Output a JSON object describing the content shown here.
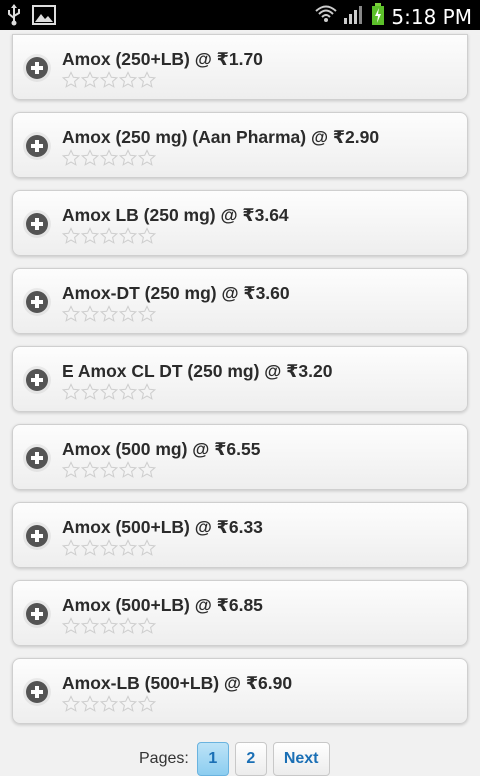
{
  "status_bar": {
    "time": "5:18 PM",
    "icons": [
      "usb-icon",
      "image-icon",
      "wifi-icon",
      "signal-icon",
      "battery-icon"
    ]
  },
  "items": [
    {
      "title": "Amox (250+LB) @ ₹1.70",
      "rating": 0
    },
    {
      "title": "Amox (250 mg) (Aan Pharma) @ ₹2.90",
      "rating": 0
    },
    {
      "title": "Amox LB (250 mg) @ ₹3.64",
      "rating": 0
    },
    {
      "title": "Amox-DT (250 mg) @ ₹3.60",
      "rating": 0
    },
    {
      "title": "E Amox CL DT (250 mg) @ ₹3.20",
      "rating": 0
    },
    {
      "title": "Amox (500 mg) @ ₹6.55",
      "rating": 0
    },
    {
      "title": "Amox (500+LB) @ ₹6.33",
      "rating": 0
    },
    {
      "title": "Amox (500+LB) @ ₹6.85",
      "rating": 0
    },
    {
      "title": "Amox-LB (500+LB) @ ₹6.90",
      "rating": 0
    }
  ],
  "pagination": {
    "label": "Pages:",
    "pages": [
      "1",
      "2"
    ],
    "current": "1",
    "next_label": "Next"
  }
}
